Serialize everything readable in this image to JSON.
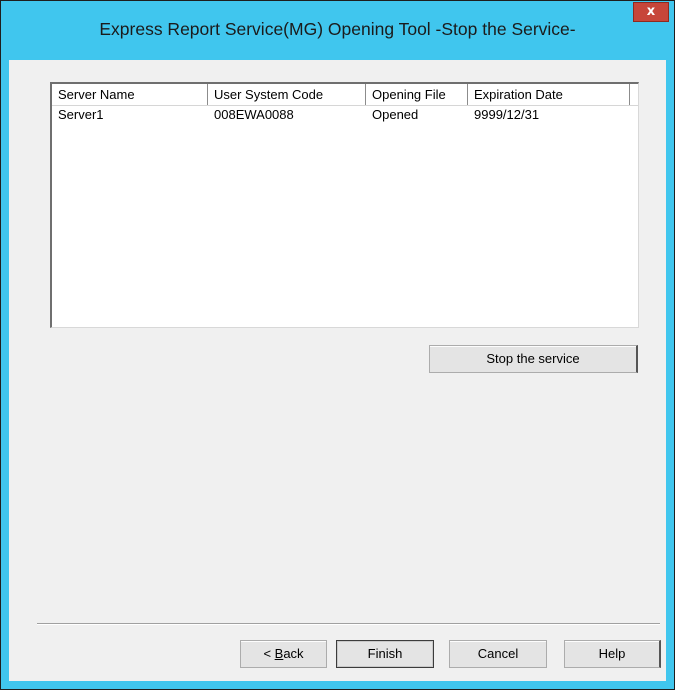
{
  "window": {
    "title": "Express Report Service(MG)  Opening Tool  -Stop the Service-",
    "close_glyph": "x"
  },
  "list": {
    "columns": [
      "Server Name",
      "User System Code",
      "Opening File",
      "Expiration Date"
    ],
    "rows": [
      [
        "Server1",
        "008EWA0088",
        "Opened",
        "9999/12/31"
      ]
    ]
  },
  "buttons": {
    "stop_service": "Stop the service",
    "back_prefix": "< ",
    "back_mnemonic": "B",
    "back_rest": "ack",
    "finish": "Finish",
    "cancel": "Cancel",
    "help": "Help"
  },
  "colors": {
    "title_bar": "#40c6ee",
    "close_button": "#c7463a",
    "dialog_bg": "#f0f0f0"
  }
}
